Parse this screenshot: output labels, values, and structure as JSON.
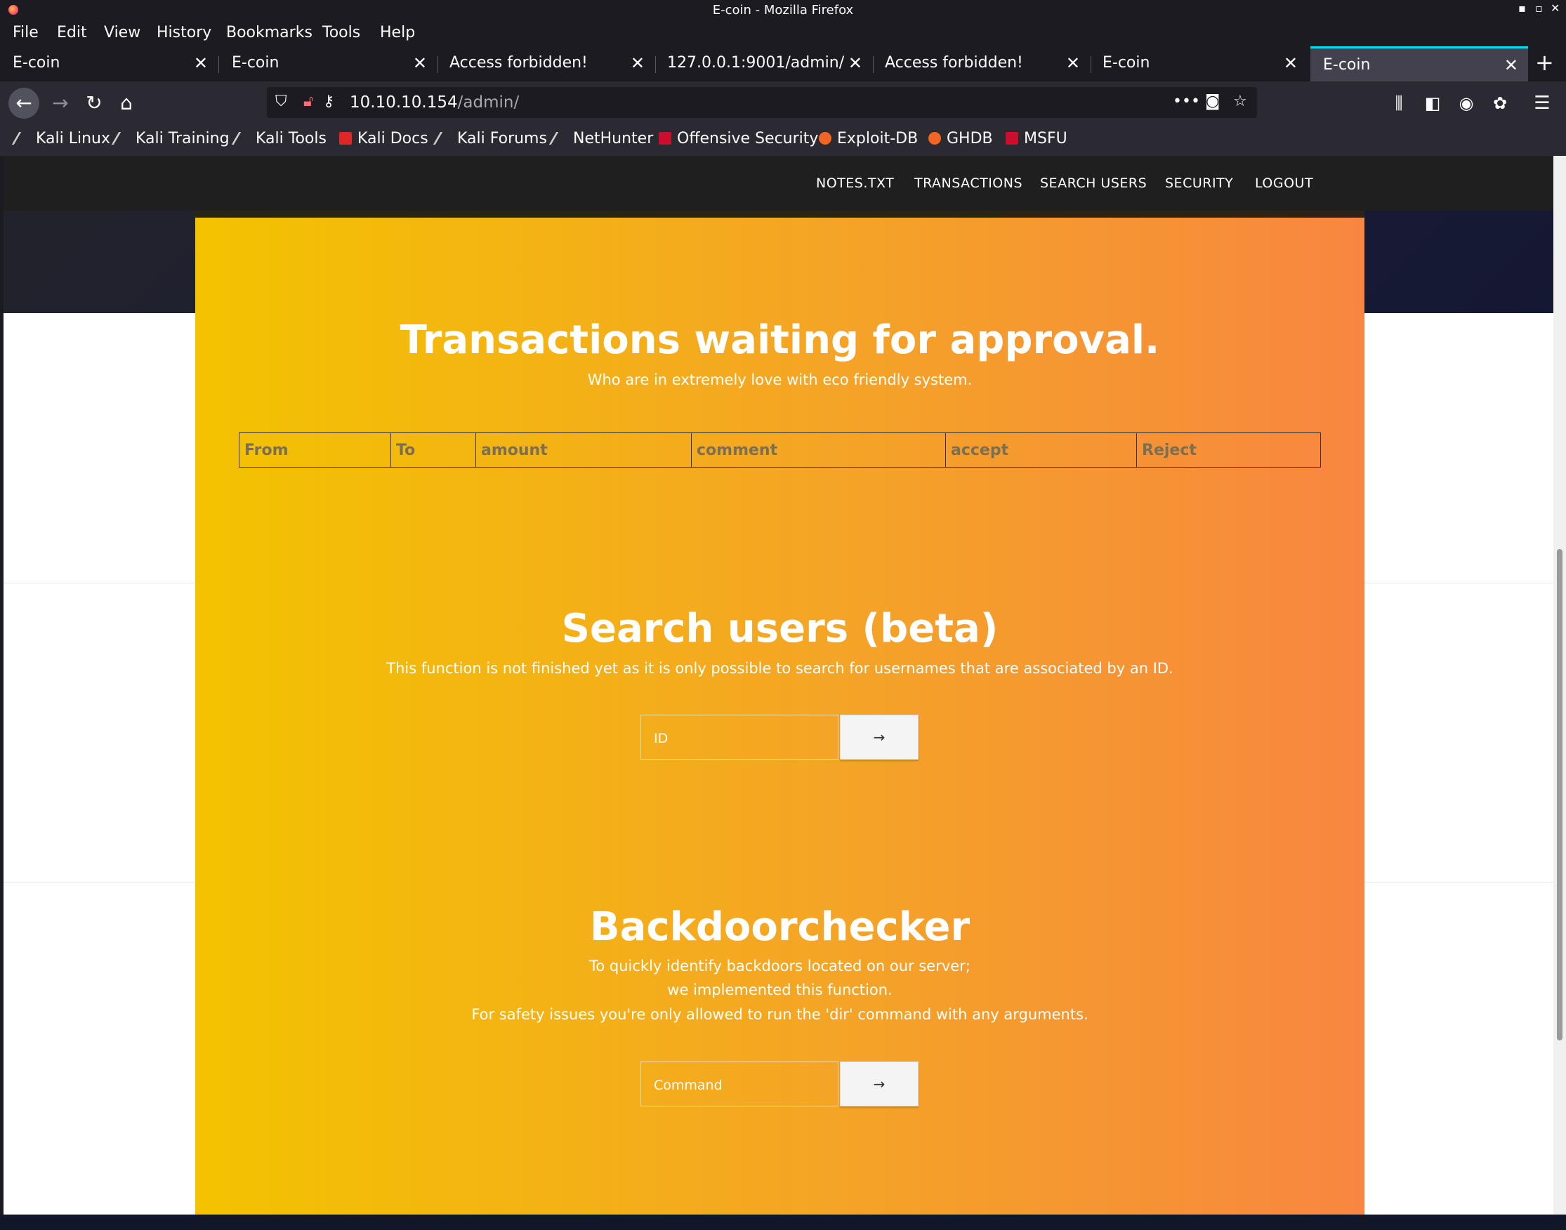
{
  "window": {
    "title": "E-coin - Mozilla Firefox"
  },
  "menu": [
    "File",
    "Edit",
    "View",
    "History",
    "Bookmarks",
    "Tools",
    "Help"
  ],
  "tabs": [
    {
      "label": "E-coin"
    },
    {
      "label": "E-coin"
    },
    {
      "label": "Access forbidden!"
    },
    {
      "label": "127.0.0.1:9001/admin/"
    },
    {
      "label": "Access forbidden!"
    },
    {
      "label": "E-coin"
    },
    {
      "label": "E-coin"
    }
  ],
  "url": {
    "host": "10.10.10.154",
    "path": "/admin/"
  },
  "bookmarks": [
    "Kali Linux",
    "Kali Training",
    "Kali Tools",
    "Kali Docs",
    "Kali Forums",
    "NetHunter",
    "Offensive Security",
    "Exploit-DB",
    "GHDB",
    "MSFU"
  ],
  "site_nav": [
    "NOTES.TXT",
    "TRANSACTIONS",
    "SEARCH USERS",
    "SECURITY",
    "LOGOUT"
  ],
  "transactions": {
    "title": "Transactions waiting for approval.",
    "subtitle": "Who are in extremely love with eco friendly system.",
    "columns": [
      "From",
      "To",
      "amount",
      "comment",
      "accept",
      "Reject"
    ]
  },
  "search": {
    "title": "Search users (beta)",
    "subtitle": "This function is not finished yet as it is only possible to search for usernames that are associated by an ID.",
    "placeholder": "ID",
    "button": "→"
  },
  "backdoor": {
    "title": "Backdoorchecker",
    "line1": "To quickly identify backdoors located on our server;",
    "line2": "we implemented this function.",
    "line3": "For safety issues you're only allowed to run the 'dir' command with any arguments.",
    "placeholder": "Command",
    "button": "→"
  },
  "colors": {
    "panel_left": "#f3c300",
    "panel_right": "#f88640",
    "active_tab_accent": "#00ddff"
  }
}
